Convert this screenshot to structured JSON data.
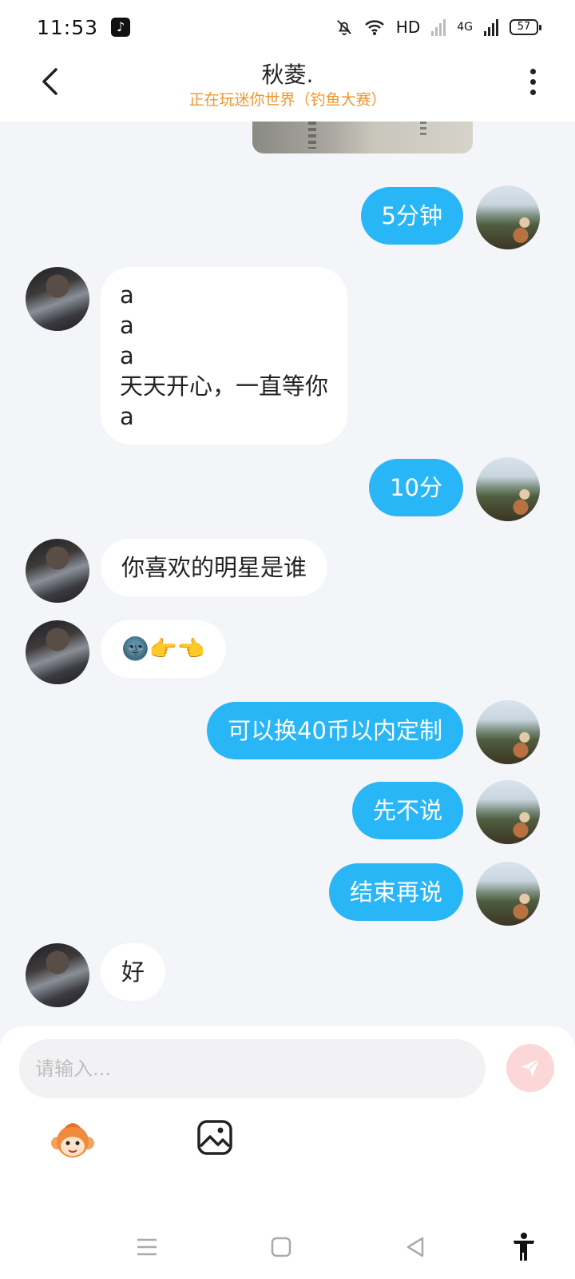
{
  "status_bar": {
    "time": "11:53",
    "network_label": "HD",
    "cell_label": "4G",
    "battery": "57"
  },
  "header": {
    "title": "秋菱.",
    "subtitle": "正在玩迷你世界（钓鱼大赛）"
  },
  "messages": [
    {
      "sender": "me",
      "text": "5分钟"
    },
    {
      "sender": "peer",
      "text": "a\na\na\n天天开心，一直等你\na"
    },
    {
      "sender": "me",
      "text": "10分"
    },
    {
      "sender": "peer",
      "text": "你喜欢的明星是谁"
    },
    {
      "sender": "peer",
      "text": "🌚👉👈"
    },
    {
      "sender": "me",
      "text": "可以换40币以内定制"
    },
    {
      "sender": "me",
      "text": "先不说"
    },
    {
      "sender": "me",
      "text": "结束再说"
    },
    {
      "sender": "peer",
      "text": "好"
    }
  ],
  "composer": {
    "placeholder": "请输入..."
  },
  "icons": {
    "back": "back-arrow-icon",
    "more": "more-vertical-icon",
    "send": "send-icon",
    "emoji": "monkey-emoji-icon",
    "image": "image-icon",
    "nav_menu": "menu-lines-icon",
    "nav_home": "square-home-icon",
    "nav_back": "triangle-back-icon",
    "accessibility": "accessibility-icon"
  },
  "colors": {
    "my_bubble": "#29b6f6",
    "peer_bubble": "#ffffff",
    "background": "#f4f5f9",
    "subtitle": "#f0962c",
    "send_button": "#fcd7d7"
  }
}
